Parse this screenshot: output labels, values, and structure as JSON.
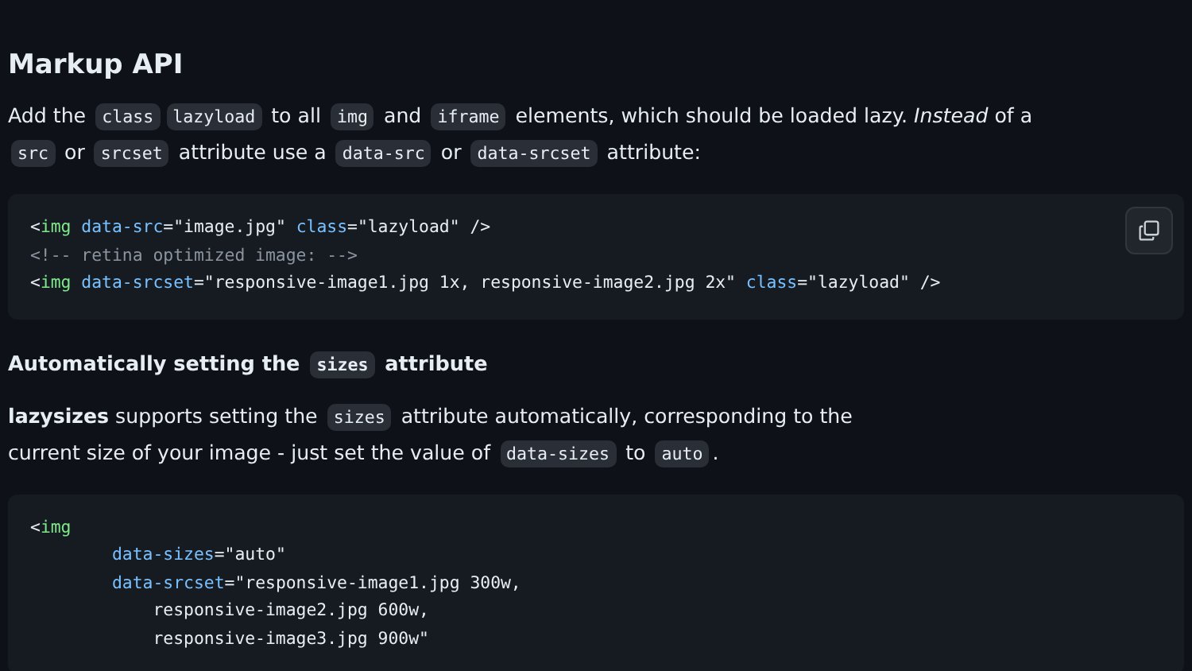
{
  "sections": [
    {
      "heading": [
        {
          "kind": "text",
          "text": "Markup API"
        }
      ],
      "kind": "h2",
      "paragraph": [
        {
          "kind": "text",
          "text": "Add the "
        },
        {
          "kind": "code",
          "text": "class"
        },
        {
          "kind": "code",
          "text": "lazyload"
        },
        {
          "kind": "text",
          "text": " to all "
        },
        {
          "kind": "code",
          "text": "img"
        },
        {
          "kind": "text",
          "text": " and "
        },
        {
          "kind": "code",
          "text": "iframe"
        },
        {
          "kind": "text",
          "text": " elements, which should be loaded lazy. *Instead* of a "
        },
        {
          "kind": "code",
          "text": "src"
        },
        {
          "kind": "text",
          "text": " or "
        },
        {
          "kind": "code",
          "text": "srcset"
        },
        {
          "kind": "text",
          "text": " attribute use a "
        },
        {
          "kind": "code",
          "text": "data-src"
        },
        {
          "kind": "text",
          "text": " or "
        },
        {
          "kind": "code",
          "text": "data-srcset"
        },
        {
          "kind": "text",
          "text": " attribute:"
        }
      ],
      "code": {
        "copy_button": true,
        "lines": [
          [
            {
              "kind": "punct",
              "text": "<"
            },
            {
              "kind": "tag",
              "text": "img"
            },
            {
              "kind": "attr",
              "text": " data-src"
            },
            {
              "kind": "punct",
              "text": "="
            },
            {
              "kind": "string",
              "text": "\"image.jpg\""
            },
            {
              "kind": "attr",
              "text": " class"
            },
            {
              "kind": "punct",
              "text": "="
            },
            {
              "kind": "string",
              "text": "\"lazyload\""
            },
            {
              "kind": "punct",
              "text": " />"
            }
          ],
          [
            {
              "kind": "comment",
              "text": "<!-- retina optimized image: -->"
            }
          ],
          [
            {
              "kind": "punct",
              "text": "<"
            },
            {
              "kind": "tag",
              "text": "img"
            },
            {
              "kind": "attr",
              "text": " data-srcset"
            },
            {
              "kind": "punct",
              "text": "="
            },
            {
              "kind": "string",
              "text": "\"responsive-image1.jpg 1x, responsive-image2.jpg 2x\""
            },
            {
              "kind": "attr",
              "text": " class"
            },
            {
              "kind": "punct",
              "text": "="
            },
            {
              "kind": "string",
              "text": "\"lazyload\""
            },
            {
              "kind": "punct",
              "text": " />"
            }
          ]
        ]
      }
    },
    {
      "heading": [
        {
          "kind": "text",
          "text": "Automatically setting the "
        },
        {
          "kind": "code",
          "text": "sizes"
        },
        {
          "kind": "text",
          "text": " attribute"
        }
      ],
      "kind": "h4",
      "paragraph": [
        {
          "kind": "text",
          "text": "**lazysizes** supports setting the "
        },
        {
          "kind": "code",
          "text": "sizes"
        },
        {
          "kind": "text",
          "text": " attribute automatically, corresponding to the current size of your image - just set the value of "
        },
        {
          "kind": "code",
          "text": "data-sizes"
        },
        {
          "kind": "text",
          "text": " to "
        },
        {
          "kind": "code",
          "text": "auto"
        },
        {
          "kind": "text",
          "text": "."
        }
      ],
      "code": {
        "copy_button": false,
        "lines": [
          [
            {
              "kind": "punct",
              "text": "<"
            },
            {
              "kind": "tag",
              "text": "img"
            }
          ],
          [
            {
              "kind": "attr",
              "text": "        data-sizes"
            },
            {
              "kind": "punct",
              "text": "="
            },
            {
              "kind": "string",
              "text": "\"auto\""
            }
          ],
          [
            {
              "kind": "attr",
              "text": "        data-srcset"
            },
            {
              "kind": "punct",
              "text": "="
            },
            {
              "kind": "string",
              "text": "\"responsive-image1.jpg 300w,"
            }
          ],
          [
            {
              "kind": "string",
              "text": "            responsive-image2.jpg 600w,"
            }
          ],
          [
            {
              "kind": "string",
              "text": "            responsive-image3.jpg 900w\""
            }
          ]
        ]
      }
    }
  ]
}
